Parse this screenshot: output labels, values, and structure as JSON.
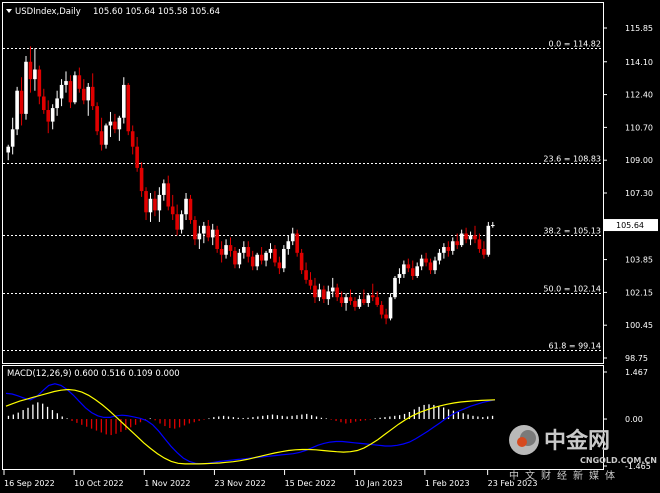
{
  "header": {
    "symbol": "USDIndex,Daily",
    "ohlc": "105.60 105.64 105.58 105.64"
  },
  "macd_label": "MACD(12,26,9) 0.600 0.516 0.109 0.000",
  "watermark": {
    "name": "中金网",
    "url": "CNGOLD.COM.CN",
    "sub": "中文财经新媒体"
  },
  "colors": {
    "bull": "#ffffff",
    "bear": "#e00000",
    "grid": "#ffffff",
    "macd_signal": "#ffff00",
    "macd_line": "#0000ff",
    "hist_pos": "#ffffff",
    "hist_neg": "#e00000",
    "price_box": "#ffffff"
  },
  "chart_data": [
    {
      "type": "candlestick",
      "title": "USDIndex,Daily",
      "x_tick_labels": [
        "16 Sep 2022",
        "10 Oct 2022",
        "1 Nov 2022",
        "23 Nov 2022",
        "15 Dec 2022",
        "10 Jan 2023",
        "1 Feb 2023",
        "23 Feb 2023"
      ],
      "y_tick_labels": [
        "115.85",
        "114.10",
        "112.40",
        "110.70",
        "109.00",
        "107.30",
        "105.64",
        "103.85",
        "102.15",
        "100.45",
        "98.75"
      ],
      "ylim": [
        98.75,
        115.85
      ],
      "current_price": 105.64,
      "fibonacci": [
        {
          "label": "0.0 = 114.82",
          "value": 114.82
        },
        {
          "label": "23.6 = 108.83",
          "value": 108.83
        },
        {
          "label": "38.2 = 105.13",
          "value": 105.13
        },
        {
          "label": "50.0 = 102.14",
          "value": 102.14
        },
        {
          "label": "61.8 = 99.14",
          "value": 99.14
        }
      ],
      "candles": [
        [
          109.4,
          109.8,
          109.0,
          109.7
        ],
        [
          109.7,
          111.2,
          109.3,
          110.6
        ],
        [
          110.6,
          112.8,
          110.3,
          112.6
        ],
        [
          112.6,
          113.3,
          110.8,
          111.4
        ],
        [
          111.4,
          114.4,
          111.1,
          114.1
        ],
        [
          114.1,
          114.9,
          112.5,
          113.2
        ],
        [
          113.2,
          114.8,
          112.6,
          113.7
        ],
        [
          113.7,
          113.9,
          111.9,
          112.3
        ],
        [
          112.3,
          112.7,
          111.4,
          111.6
        ],
        [
          111.6,
          112.1,
          110.4,
          111.0
        ],
        [
          111.0,
          111.9,
          110.6,
          111.7
        ],
        [
          111.7,
          112.6,
          111.3,
          112.2
        ],
        [
          112.2,
          113.2,
          111.8,
          112.9
        ],
        [
          112.9,
          113.6,
          112.5,
          113.1
        ],
        [
          113.1,
          113.4,
          111.7,
          112.0
        ],
        [
          112.0,
          113.6,
          111.9,
          113.4
        ],
        [
          113.4,
          113.8,
          112.5,
          112.7
        ],
        [
          112.7,
          113.2,
          111.9,
          112.1
        ],
        [
          112.1,
          113.0,
          111.3,
          112.8
        ],
        [
          112.8,
          113.5,
          111.6,
          111.8
        ],
        [
          111.8,
          112.0,
          110.3,
          110.5
        ],
        [
          110.5,
          111.2,
          109.5,
          109.8
        ],
        [
          109.8,
          110.9,
          109.6,
          110.8
        ],
        [
          110.8,
          111.5,
          110.2,
          111.0
        ],
        [
          111.0,
          111.4,
          110.4,
          110.6
        ],
        [
          110.6,
          111.3,
          110.0,
          111.2
        ],
        [
          111.2,
          113.3,
          110.9,
          112.9
        ],
        [
          112.9,
          113.0,
          110.3,
          110.5
        ],
        [
          110.5,
          110.8,
          109.3,
          109.7
        ],
        [
          109.7,
          110.2,
          108.4,
          108.6
        ],
        [
          108.6,
          108.9,
          107.1,
          107.4
        ],
        [
          107.4,
          107.6,
          105.9,
          106.3
        ],
        [
          106.3,
          107.3,
          105.8,
          107.0
        ],
        [
          107.0,
          107.4,
          106.1,
          106.4
        ],
        [
          106.4,
          107.6,
          105.8,
          107.2
        ],
        [
          107.2,
          108.0,
          106.9,
          107.8
        ],
        [
          107.8,
          108.2,
          106.4,
          106.6
        ],
        [
          106.6,
          107.2,
          105.9,
          106.2
        ],
        [
          106.2,
          106.7,
          105.1,
          105.4
        ],
        [
          105.4,
          106.4,
          105.2,
          106.2
        ],
        [
          106.2,
          107.3,
          105.9,
          107.0
        ],
        [
          107.0,
          107.2,
          105.7,
          105.9
        ],
        [
          105.9,
          106.1,
          104.6,
          104.9
        ],
        [
          104.9,
          105.6,
          104.4,
          105.2
        ],
        [
          105.2,
          105.8,
          104.7,
          105.6
        ],
        [
          105.6,
          105.9,
          104.8,
          105.0
        ],
        [
          105.0,
          105.7,
          104.6,
          105.4
        ],
        [
          105.4,
          105.6,
          104.2,
          104.4
        ],
        [
          104.4,
          104.8,
          103.7,
          104.1
        ],
        [
          104.1,
          104.9,
          103.9,
          104.6
        ],
        [
          104.6,
          105.0,
          104.0,
          104.3
        ],
        [
          104.3,
          104.5,
          103.4,
          103.6
        ],
        [
          103.6,
          104.4,
          103.4,
          104.2
        ],
        [
          104.2,
          104.8,
          103.9,
          104.5
        ],
        [
          104.5,
          104.8,
          103.7,
          104.0
        ],
        [
          104.0,
          104.3,
          103.3,
          103.5
        ],
        [
          103.5,
          104.2,
          103.3,
          104.1
        ],
        [
          104.1,
          104.5,
          103.6,
          103.8
        ],
        [
          103.8,
          104.3,
          103.5,
          104.2
        ],
        [
          104.2,
          104.7,
          103.9,
          104.4
        ],
        [
          104.4,
          104.6,
          103.5,
          103.7
        ],
        [
          103.7,
          104.0,
          103.1,
          103.4
        ],
        [
          103.4,
          104.6,
          103.2,
          104.4
        ],
        [
          104.4,
          105.1,
          104.1,
          104.8
        ],
        [
          104.8,
          105.5,
          104.6,
          105.2
        ],
        [
          105.2,
          105.4,
          104.0,
          104.2
        ],
        [
          104.2,
          104.4,
          103.1,
          103.3
        ],
        [
          103.3,
          103.7,
          102.6,
          102.8
        ],
        [
          102.8,
          103.2,
          102.3,
          102.5
        ],
        [
          102.5,
          102.9,
          101.6,
          101.9
        ],
        [
          101.9,
          102.6,
          101.7,
          102.3
        ],
        [
          102.3,
          102.5,
          101.6,
          101.8
        ],
        [
          101.8,
          102.5,
          101.5,
          102.2
        ],
        [
          102.2,
          102.9,
          101.9,
          102.4
        ],
        [
          102.4,
          102.6,
          101.7,
          101.9
        ],
        [
          101.9,
          102.2,
          101.4,
          101.6
        ],
        [
          101.6,
          102.1,
          101.2,
          101.9
        ],
        [
          101.9,
          102.3,
          101.5,
          101.7
        ],
        [
          101.7,
          101.9,
          101.2,
          101.4
        ],
        [
          101.4,
          102.0,
          101.3,
          101.8
        ],
        [
          101.8,
          102.3,
          101.5,
          101.6
        ],
        [
          101.6,
          102.1,
          101.4,
          102.0
        ],
        [
          102.0,
          102.6,
          101.7,
          101.9
        ],
        [
          101.9,
          102.2,
          101.4,
          101.5
        ],
        [
          101.5,
          101.7,
          100.8,
          101.0
        ],
        [
          101.0,
          101.3,
          100.5,
          100.8
        ],
        [
          100.8,
          102.1,
          100.7,
          101.9
        ],
        [
          101.9,
          103.0,
          101.8,
          102.9
        ],
        [
          102.9,
          103.4,
          102.6,
          103.1
        ],
        [
          103.1,
          103.8,
          102.9,
          103.6
        ],
        [
          103.6,
          103.9,
          103.2,
          103.4
        ],
        [
          103.4,
          103.8,
          102.8,
          103.0
        ],
        [
          103.0,
          103.7,
          102.9,
          103.5
        ],
        [
          103.5,
          104.1,
          103.3,
          103.9
        ],
        [
          103.9,
          104.2,
          103.5,
          103.7
        ],
        [
          103.7,
          103.9,
          103.1,
          103.3
        ],
        [
          103.3,
          104.0,
          103.1,
          103.8
        ],
        [
          103.8,
          104.4,
          103.6,
          104.2
        ],
        [
          104.2,
          104.7,
          103.9,
          104.5
        ],
        [
          104.5,
          104.8,
          104.0,
          104.3
        ],
        [
          104.3,
          105.0,
          104.1,
          104.8
        ],
        [
          104.8,
          105.2,
          104.4,
          104.6
        ],
        [
          104.6,
          105.4,
          104.5,
          105.2
        ],
        [
          105.2,
          105.5,
          104.7,
          104.9
        ],
        [
          104.9,
          105.3,
          104.6,
          105.1
        ],
        [
          105.1,
          105.6,
          104.7,
          104.9
        ],
        [
          104.9,
          105.2,
          104.2,
          104.4
        ],
        [
          104.4,
          104.8,
          103.9,
          104.1
        ],
        [
          104.1,
          105.8,
          104.0,
          105.6
        ],
        [
          105.6,
          105.8,
          105.5,
          105.64
        ]
      ]
    },
    {
      "type": "macd",
      "title": "MACD(12,26,9) 0.600 0.516 0.109 0.000",
      "y_tick_labels": [
        "1.467",
        "0.00",
        "-1.465"
      ],
      "ylim": [
        -1.465,
        1.467
      ],
      "values": {
        "macd": 0.6,
        "signal": 0.516,
        "histogram": 0.109,
        "extra": 0.0
      },
      "histogram": [
        0.1,
        0.14,
        0.2,
        0.28,
        0.35,
        0.45,
        0.52,
        0.48,
        0.38,
        0.28,
        0.18,
        0.08,
        0.02,
        -0.06,
        -0.12,
        -0.18,
        -0.24,
        -0.3,
        -0.36,
        -0.42,
        -0.48,
        -0.5,
        -0.46,
        -0.4,
        -0.34,
        -0.26,
        -0.18,
        -0.1,
        -0.04,
        0.02,
        -0.04,
        -0.14,
        -0.22,
        -0.28,
        -0.3,
        -0.26,
        -0.2,
        -0.14,
        -0.1,
        -0.06,
        -0.02,
        0.02,
        0.06,
        0.08,
        0.1,
        0.08,
        0.06,
        0.04,
        0.03,
        0.04,
        0.06,
        0.08,
        0.1,
        0.12,
        0.14,
        0.12,
        0.1,
        0.08,
        0.1,
        0.12,
        0.14,
        0.16,
        0.12,
        0.08,
        0.04,
        0.02,
        -0.02,
        -0.06,
        -0.1,
        -0.14,
        -0.12,
        -0.08,
        -0.06,
        -0.04,
        -0.02,
        0.02,
        0.04,
        0.06,
        0.08,
        0.1,
        0.12,
        0.16,
        0.22,
        0.3,
        0.38,
        0.44,
        0.46,
        0.44,
        0.4,
        0.36,
        0.3,
        0.26,
        0.22,
        0.18,
        0.14,
        0.1,
        0.08,
        0.06,
        0.08,
        0.1
      ],
      "macd_line": [
        0.8,
        0.78,
        0.72,
        0.65,
        0.6,
        0.7,
        0.88,
        1.05,
        1.1,
        1.05,
        0.92,
        0.75,
        0.55,
        0.35,
        0.2,
        0.1,
        0.05,
        0.05,
        0.1,
        0.12,
        0.1,
        0.06,
        0.02,
        -0.05,
        -0.18,
        -0.38,
        -0.62,
        -0.85,
        -1.05,
        -1.22,
        -1.32,
        -1.38,
        -1.4,
        -1.38,
        -1.35,
        -1.32,
        -1.3,
        -1.28,
        -1.26,
        -1.24,
        -1.22,
        -1.2,
        -1.18,
        -1.16,
        -1.14,
        -1.12,
        -1.1,
        -1.08,
        -1.04,
        -0.98,
        -0.9,
        -0.82,
        -0.76,
        -0.72,
        -0.7,
        -0.7,
        -0.72,
        -0.74,
        -0.76,
        -0.78,
        -0.8,
        -0.82,
        -0.84,
        -0.84,
        -0.82,
        -0.78,
        -0.72,
        -0.62,
        -0.5,
        -0.38,
        -0.25,
        -0.12,
        0.02,
        0.14,
        0.24,
        0.32,
        0.4,
        0.46,
        0.52,
        0.56,
        0.6
      ],
      "signal_line": [
        0.4,
        0.48,
        0.56,
        0.62,
        0.68,
        0.74,
        0.8,
        0.86,
        0.9,
        0.92,
        0.9,
        0.84,
        0.74,
        0.6,
        0.44,
        0.26,
        0.06,
        -0.14,
        -0.34,
        -0.54,
        -0.74,
        -0.92,
        -1.08,
        -1.22,
        -1.32,
        -1.38,
        -1.4,
        -1.4,
        -1.4,
        -1.39,
        -1.38,
        -1.37,
        -1.35,
        -1.33,
        -1.3,
        -1.26,
        -1.21,
        -1.16,
        -1.11,
        -1.06,
        -1.02,
        -0.98,
        -0.96,
        -0.95,
        -0.95,
        -0.96,
        -0.98,
        -1.0,
        -1.02,
        -1.03,
        -1.02,
        -0.98,
        -0.9,
        -0.78,
        -0.64,
        -0.48,
        -0.32,
        -0.16,
        -0.02,
        0.1,
        0.2,
        0.28,
        0.35,
        0.41,
        0.46,
        0.5,
        0.53,
        0.55,
        0.57,
        0.58,
        0.59,
        0.6
      ]
    }
  ]
}
